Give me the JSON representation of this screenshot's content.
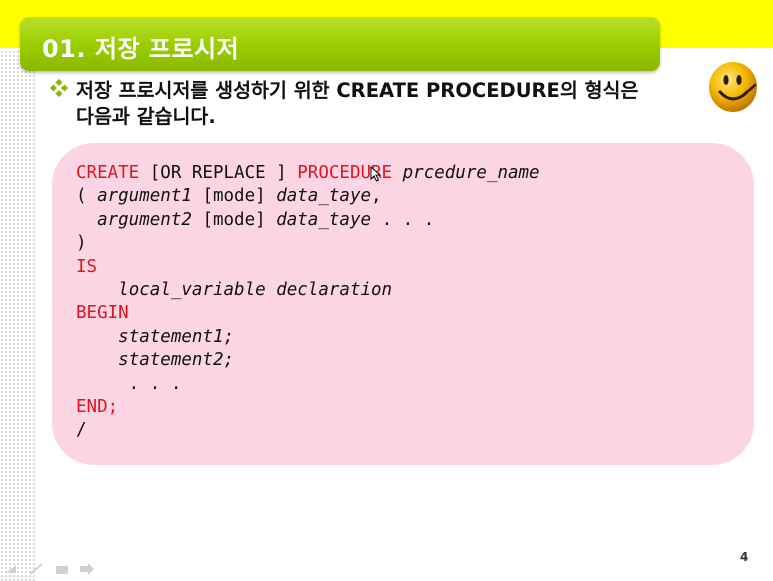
{
  "slide": {
    "title": "01. 저장 프로시저",
    "bullet_line1": "저장 프로시저를 생성하기 위한 CREATE PROCEDURE의 형식은",
    "bullet_line2": "다음과 같습니다.",
    "page_number": "4"
  },
  "code": {
    "l1_kw1": "CREATE",
    "l1_opt": " [OR REPLACE ] ",
    "l1_kw2": "PROCEDURE",
    "l1_name": " prcedure_name",
    "l2_paren": "( ",
    "l2_arg": "argument1",
    "l2_mode": " [mode] ",
    "l2_type": "data_taye",
    "l2_comma": ",",
    "l3_indent": "  ",
    "l3_arg": "argument2",
    "l3_mode": " [mode] ",
    "l3_type": "data_taye",
    "l3_dots": " . . .",
    "l4": ")",
    "l5_kw": "IS",
    "l6_indent": "    ",
    "l6_text": "local_variable declaration",
    "l7_kw": "BEGIN",
    "l8_indent": "    ",
    "l8_text": "statement1;",
    "l9_indent": "    ",
    "l9_text": "statement2;",
    "l10": "     . . .",
    "l11_kw": "END;",
    "l12": "/"
  },
  "colors": {
    "banner": "#ffff00",
    "title_bar": "#99cc00",
    "code_box": "#fcd5e5",
    "keyword": "#e0141f"
  },
  "icons": [
    "diamond-bullet-icon",
    "smiley-face-icon",
    "mouse-cursor-icon",
    "slide-nav-icons"
  ]
}
